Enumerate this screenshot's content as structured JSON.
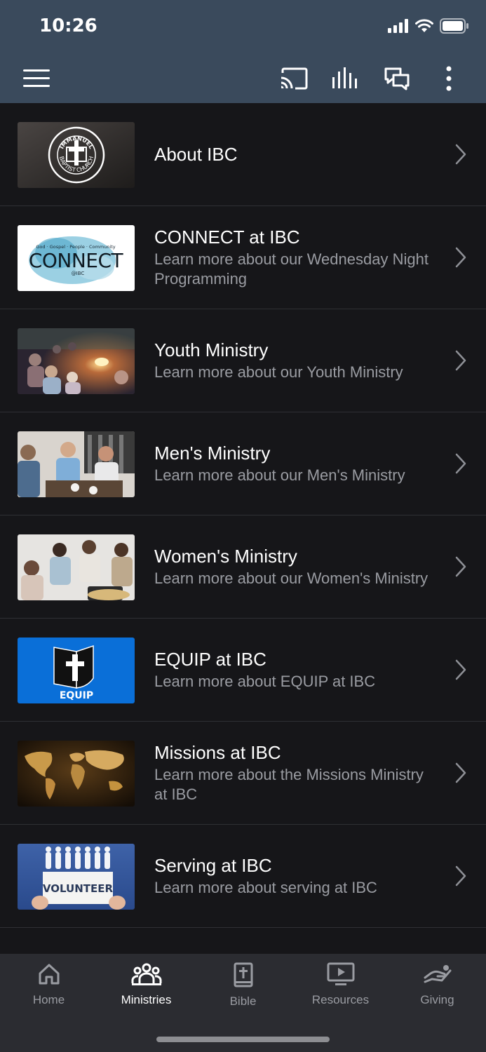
{
  "status_bar": {
    "time": "10:26"
  },
  "items": [
    {
      "title": "About IBC",
      "subtitle": ""
    },
    {
      "title": "CONNECT at IBC",
      "subtitle": "Learn more about our Wednesday Night Programming"
    },
    {
      "title": "Youth Ministry",
      "subtitle": "Learn more about our Youth Ministry"
    },
    {
      "title": "Men's Ministry",
      "subtitle": "Learn more about our Men's Ministry"
    },
    {
      "title": "Women's Ministry",
      "subtitle": "Learn more about our Women's Ministry"
    },
    {
      "title": "EQUIP at IBC",
      "subtitle": "Learn more about EQUIP at IBC"
    },
    {
      "title": "Missions at IBC",
      "subtitle": "Learn more about the Missions Ministry at IBC"
    },
    {
      "title": "Serving at IBC",
      "subtitle": "Learn more about serving at IBC"
    }
  ],
  "thumb_text": {
    "logo_top": "IMMANUEL",
    "logo_bottom": "BAPTIST CHURCH",
    "connect_tagline": "God · Gospel · People · Community",
    "connect_word": "CONNECT",
    "connect_sub": "@IBC",
    "equip": "EQUIP",
    "volunteer": "VOLUNTEER"
  },
  "tabs": [
    {
      "label": "Home",
      "icon": "home-icon"
    },
    {
      "label": "Ministries",
      "icon": "people-icon",
      "active": true
    },
    {
      "label": "Bible",
      "icon": "bible-icon"
    },
    {
      "label": "Resources",
      "icon": "video-icon"
    },
    {
      "label": "Giving",
      "icon": "giving-icon"
    }
  ],
  "colors": {
    "header": "#3a4a5c",
    "background": "#161619",
    "tab_bar": "#2b2c31",
    "equip_blue": "#0a6fd8"
  }
}
